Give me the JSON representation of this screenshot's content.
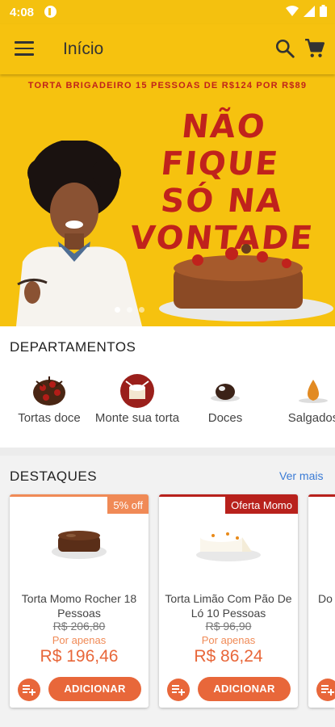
{
  "status_bar": {
    "time": "4:08"
  },
  "app_bar": {
    "title": "Início"
  },
  "banner": {
    "promo": "TORTA BRIGADEIRO 15 PESSOAS DE R$124 POR R$89",
    "headline_lines": [
      "NÃO FIQUE",
      "SÓ NA",
      "VONTADE"
    ]
  },
  "departments": {
    "heading": "DEPARTAMENTOS",
    "items": [
      {
        "label": "Tortas doce",
        "icon": "chocolate-cake-icon"
      },
      {
        "label": "Monte sua torta",
        "icon": "build-cake-icon"
      },
      {
        "label": "Doces",
        "icon": "truffle-icon"
      },
      {
        "label": "Salgados",
        "icon": "coxinha-icon"
      }
    ]
  },
  "featured": {
    "heading": "DESTAQUES",
    "see_more": "Ver mais",
    "products": [
      {
        "badge": "5% off",
        "badge_color": "#f08a56",
        "name": "Torta Momo Rocher 18 Pessoas",
        "old_price": "R$ 206,80",
        "por_apenas": "Por apenas",
        "price": "R$ 196,46",
        "add_label": "ADICIONAR"
      },
      {
        "badge": "Oferta Momo",
        "badge_color": "#b8211c",
        "name": "Torta Limão Com Pão De Ló 10 Pessoas",
        "old_price": "R$ 96,90",
        "por_apenas": "Por apenas",
        "price": "R$ 86,24",
        "add_label": "ADICIONAR"
      },
      {
        "name": "Do"
      }
    ]
  },
  "colors": {
    "brand_yellow": "#f6c20f",
    "accent_orange": "#e8673a",
    "promo_red": "#c0221c",
    "link_blue": "#3a7bd5"
  }
}
